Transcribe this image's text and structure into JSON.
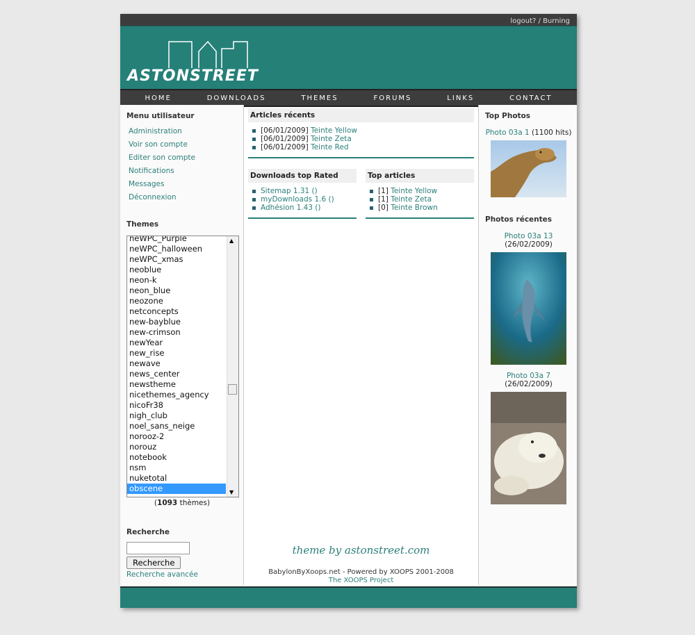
{
  "topbar": {
    "logout": "logout?",
    "sep": " / ",
    "user": "Burning"
  },
  "logo": {
    "text": "ASTONSTREET"
  },
  "nav": [
    "HOME",
    "DOWNLOADS",
    "THEMES",
    "FORUMS",
    "LINKS",
    "CONTACT"
  ],
  "left": {
    "menu_title": "Menu utilisateur",
    "menu": [
      "Administration",
      "Voir son compte",
      "Editer son compte",
      "Notifications",
      "Messages",
      "Déconnexion"
    ],
    "themes_title": "Themes",
    "themes": [
      "neWPC_Purple",
      "neWPC_halloween",
      "neWPC_xmas",
      "neoblue",
      "neon-k",
      "neon_blue",
      "neozone",
      "netconcepts",
      "new-bayblue",
      "new-crimson",
      "newYear",
      "new_rise",
      "newave",
      "news_center",
      "newstheme",
      "nicethemes_agency",
      "nicoFr38",
      "nigh_club",
      "noel_sans_neige",
      "norooz-2",
      "norouz",
      "notebook",
      "nsm",
      "nuketotal",
      "obscene"
    ],
    "selected_theme": "obscene",
    "count_open": "(",
    "count": "1093",
    "count_close": " thèmes)",
    "search_title": "Recherche",
    "search_value": "",
    "search_button": "Recherche",
    "advanced": "Recherche avancée"
  },
  "center": {
    "recent_title": "Articles récents",
    "recent": [
      {
        "date": "[06/01/2009]",
        "title": "Teinte Yellow"
      },
      {
        "date": "[06/01/2009]",
        "title": "Teinte Zeta"
      },
      {
        "date": "[06/01/2009]",
        "title": "Teinte Red"
      }
    ],
    "downloads_title": "Downloads top Rated",
    "downloads": [
      "Sitemap 1.31 ()",
      "myDownloads 1.6 ()",
      "Adhésion 1.43 ()"
    ],
    "top_title": "Top articles",
    "top": [
      {
        "count": "[1]",
        "title": "Teinte Yellow"
      },
      {
        "count": "[1]",
        "title": "Teinte Zeta"
      },
      {
        "count": "[0]",
        "title": "Teinte Brown"
      }
    ],
    "signature": "theme by astonstreet.com",
    "footer_text": "BabylonByXoops.net - Powered by XOOPS 2001-2008 ",
    "footer_link": "The XOOPS Project"
  },
  "right": {
    "top_title": "Top Photos",
    "top_photo": {
      "link": "Photo 03a 1",
      "meta": " (1100 hits)"
    },
    "recent_title": "Photos récentes",
    "recent": [
      {
        "link": "Photo 03a 13",
        "meta": " (26/02/2009)"
      },
      {
        "link": "Photo 03a 7",
        "meta": " (26/02/2009)"
      }
    ]
  },
  "colors": {
    "brand": "#258078",
    "link": "#2a7f7a",
    "nav": "#3d3d3d"
  }
}
